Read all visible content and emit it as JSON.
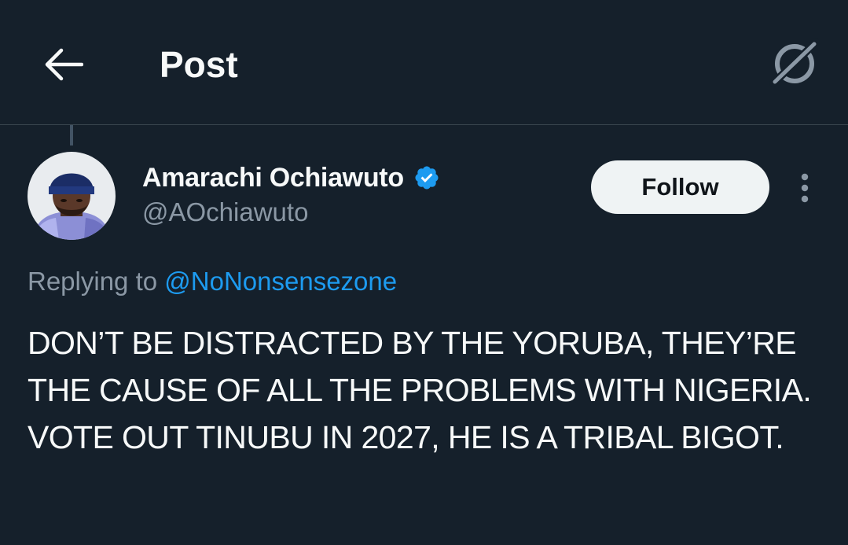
{
  "header": {
    "title": "Post",
    "back_icon": "arrow-left-icon",
    "grok_icon": "grok-icon"
  },
  "author": {
    "name": "Amarachi Ochiawuto",
    "handle": "@AOchiawuto",
    "verified_icon": "verified-badge-icon",
    "verified_color": "#1d9bf0"
  },
  "actions": {
    "follow_label": "Follow",
    "more_icon": "more-vertical-icon"
  },
  "reply": {
    "prefix": "Replying to",
    "handle": "@NoNonsensezone"
  },
  "post": {
    "text": "DON’T BE DISTRACTED BY THE YORUBA, THEY’RE THE CAUSE OF ALL THE PROBLEMS WITH NIGERIA. VOTE OUT TINUBU IN 2027, HE IS A TRIBAL BIGOT."
  },
  "colors": {
    "background": "#15202b",
    "accent": "#1d9bf0",
    "secondary_text": "#8b98a5"
  }
}
